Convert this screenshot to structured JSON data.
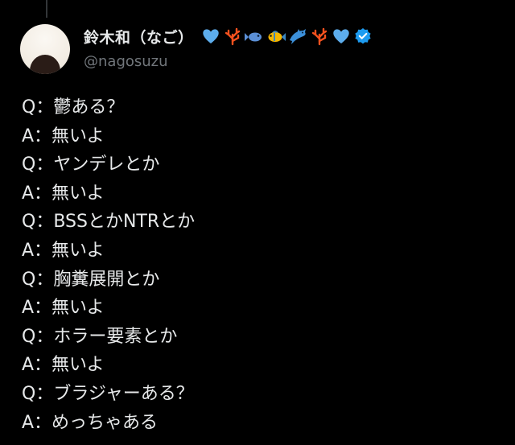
{
  "user": {
    "display_name": "鈴木和（なご）",
    "handle": "@nagosuzu",
    "emojis": [
      "blue-heart-icon",
      "coral-icon",
      "fish-icon",
      "tropical-fish-icon",
      "dolphin-icon",
      "coral-icon",
      "blue-heart-icon"
    ],
    "verified": true
  },
  "tweet": {
    "lines": [
      "Q：鬱ある？",
      "A：無いよ",
      "Q：ヤンデレとか",
      "A：無いよ",
      "Q：BSSとかNTRとか",
      "A：無いよ",
      "Q：胸糞展開とか",
      "A：無いよ",
      "Q：ホラー要素とか",
      "A：無いよ",
      "Q：ブラジャーある？",
      "A：めっちゃある"
    ]
  },
  "colors": {
    "background": "#000000",
    "text_primary": "#e7e9ea",
    "text_secondary": "#71767b",
    "verified_blue": "#1d9bf0",
    "heart_blue": "#5dadec",
    "coral": "#f4511e"
  }
}
